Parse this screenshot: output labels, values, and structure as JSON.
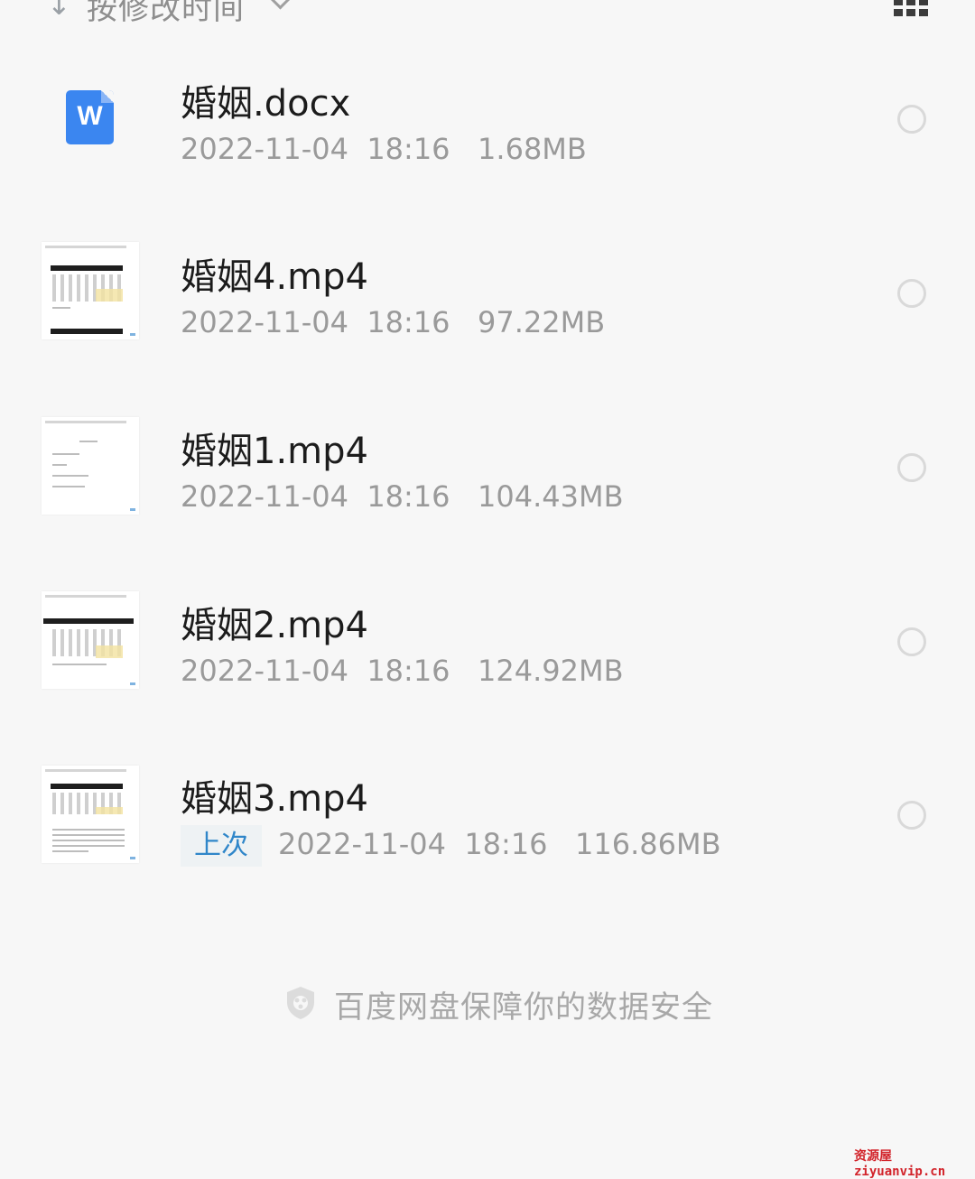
{
  "sortbar": {
    "label": "按修改时间",
    "arrow_icon": "down-arrow-icon",
    "chevron_icon": "chevron-down-icon",
    "view_icon": "grid-view-icon"
  },
  "files": [
    {
      "name": "婚姻.docx",
      "date": "2022-11-04",
      "time": "18:16",
      "size": "1.68MB",
      "icon": "word-doc-icon"
    },
    {
      "name": "婚姻4.mp4",
      "date": "2022-11-04",
      "time": "18:16",
      "size": "97.22MB",
      "icon": "video-thumbnail"
    },
    {
      "name": "婚姻1.mp4",
      "date": "2022-11-04",
      "time": "18:16",
      "size": "104.43MB",
      "icon": "video-thumbnail"
    },
    {
      "name": "婚姻2.mp4",
      "date": "2022-11-04",
      "time": "18:16",
      "size": "124.92MB",
      "icon": "video-thumbnail"
    },
    {
      "name": "婚姻3.mp4",
      "badge": "上次",
      "date": "2022-11-04",
      "time": "18:16",
      "size": "116.86MB",
      "icon": "video-thumbnail"
    }
  ],
  "footer": {
    "text": "百度网盘保障你的数据安全",
    "icon": "shield-icon"
  },
  "watermark": "资源屋ziyuanvip.cn",
  "colors": {
    "background": "#f7f7f7",
    "accent": "#3b86f0",
    "badge_text": "#2f86c9"
  }
}
